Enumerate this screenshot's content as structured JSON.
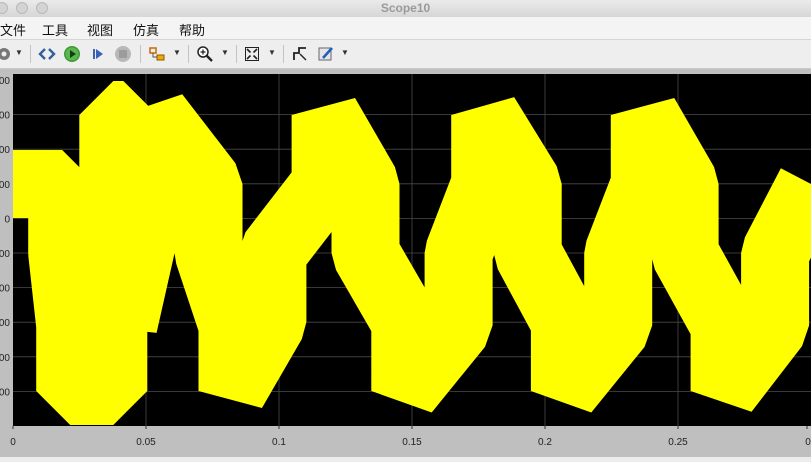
{
  "window": {
    "title": "Scope10"
  },
  "menu": {
    "items": [
      "文件",
      "工具",
      "视图",
      "仿真",
      "帮助"
    ]
  },
  "toolbar": {
    "buttons": [
      "gear-icon",
      "parameters-icon",
      "run-icon",
      "step-forward-icon",
      "stop-icon",
      "highlight-icon",
      "zoom-in-icon",
      "fit-to-view-icon",
      "cursor-measure-icon",
      "style-icon"
    ]
  },
  "plot": {
    "background": "#000000",
    "signal_color": "#ffff00",
    "grid": true
  },
  "chart_data": {
    "type": "line",
    "x_ticks": [
      "0",
      "0.05",
      "0.1",
      "0.15",
      "0.2",
      "0.25",
      "0"
    ],
    "y_ticks": [
      "00",
      "00",
      "00",
      "00",
      "0",
      "00",
      "00",
      "00",
      "00",
      "00"
    ],
    "xlim": [
      0,
      0.3
    ],
    "series": [
      {
        "color": "#ffff00",
        "x": [
          0,
          0.0185,
          0.0185,
          0.0215,
          0.0215,
          0.0377,
          0.0377,
          0.0415,
          0.0415,
          0.0535,
          0.0535,
          0.0735,
          0.0735,
          0.0825,
          0.0825,
          0.0975,
          0.0975,
          0.1175,
          0.1175,
          0.1325,
          0.1325,
          0.1475,
          0.1475,
          0.1675,
          0.1675,
          0.1775,
          0.1775,
          0.1935,
          0.1935,
          0.2075,
          0.2075,
          0.2275,
          0.2275,
          0.2375,
          0.2375,
          0.2525,
          0.2525,
          0.2675,
          0.2675,
          0.2865,
          0.2865,
          0.3
        ],
        "y": [
          1,
          1,
          0,
          -1.05,
          -2,
          -2,
          2,
          2,
          -1.05,
          1,
          2,
          1,
          0,
          -1.05,
          -2,
          -1,
          0,
          1,
          2,
          1,
          0,
          -1,
          -2,
          -1.05,
          0,
          1,
          2,
          1,
          0,
          -1,
          -2,
          -1.05,
          0,
          1,
          2,
          1,
          0,
          -1.05,
          -2,
          -1.05,
          0,
          1
        ]
      }
    ]
  }
}
